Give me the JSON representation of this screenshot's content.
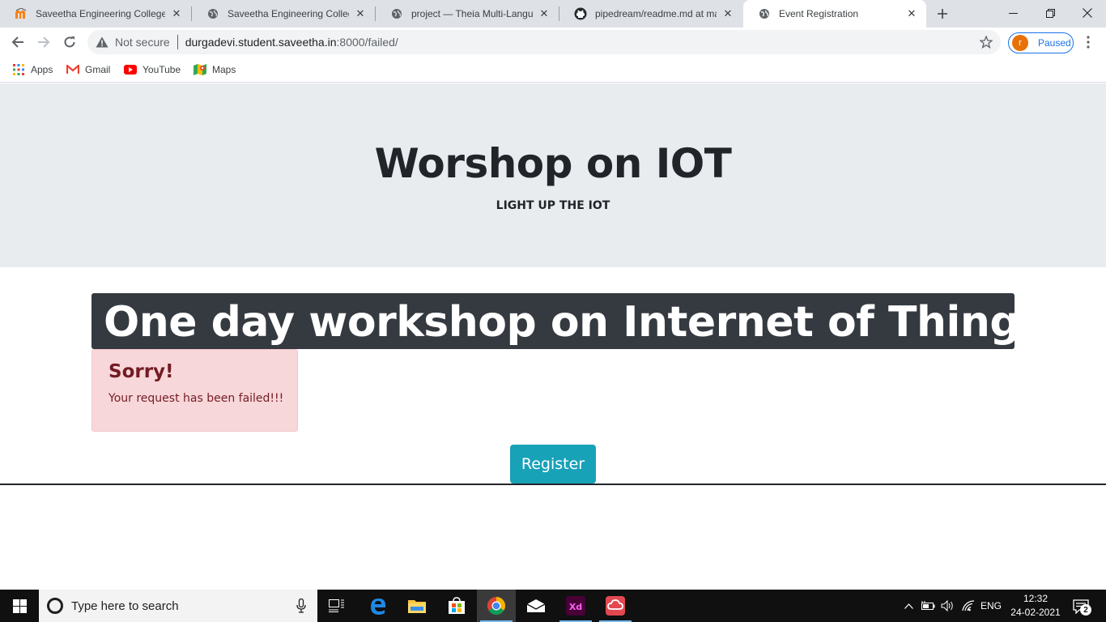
{
  "browser": {
    "tabs": [
      {
        "title": "Saveetha Engineering College",
        "favicon": "moodle-icon"
      },
      {
        "title": "Saveetha Engineering College",
        "favicon": "globe-icon"
      },
      {
        "title": "project — Theia Multi-Language",
        "favicon": "globe-icon"
      },
      {
        "title": "pipedream/readme.md at master",
        "favicon": "github-icon"
      },
      {
        "title": "Event Registration",
        "favicon": "globe-icon",
        "active": true
      }
    ],
    "omnibox": {
      "security_label": "Not secure",
      "url_host": "durgadevi.student.saveetha.in",
      "url_path": ":8000/failed/"
    },
    "profile": {
      "initial": "r",
      "status": "Paused"
    },
    "bookmarks": [
      {
        "label": "Apps",
        "icon": "apps-grid-icon"
      },
      {
        "label": "Gmail",
        "icon": "gmail-icon"
      },
      {
        "label": "YouTube",
        "icon": "youtube-icon"
      },
      {
        "label": "Maps",
        "icon": "maps-icon"
      }
    ]
  },
  "page": {
    "jumbotron_title": "Worshop on IOT",
    "jumbotron_subtitle": "LIGHT UP THE IOT",
    "banner_text": "One day workshop on Internet of Things",
    "alert": {
      "heading": "Sorry!",
      "message": "Your request has been failed!!!"
    },
    "register_button": "Register"
  },
  "taskbar": {
    "search_placeholder": "Type here to search",
    "language": "ENG",
    "time": "12:32",
    "date": "24-02-2021",
    "notification_count": "2"
  },
  "colors": {
    "jumbotron_bg": "#e9ecef",
    "banner_bg": "#343a40",
    "alert_bg": "#f8d7da",
    "alert_text": "#721c24",
    "button_bg": "#17a2b8"
  }
}
